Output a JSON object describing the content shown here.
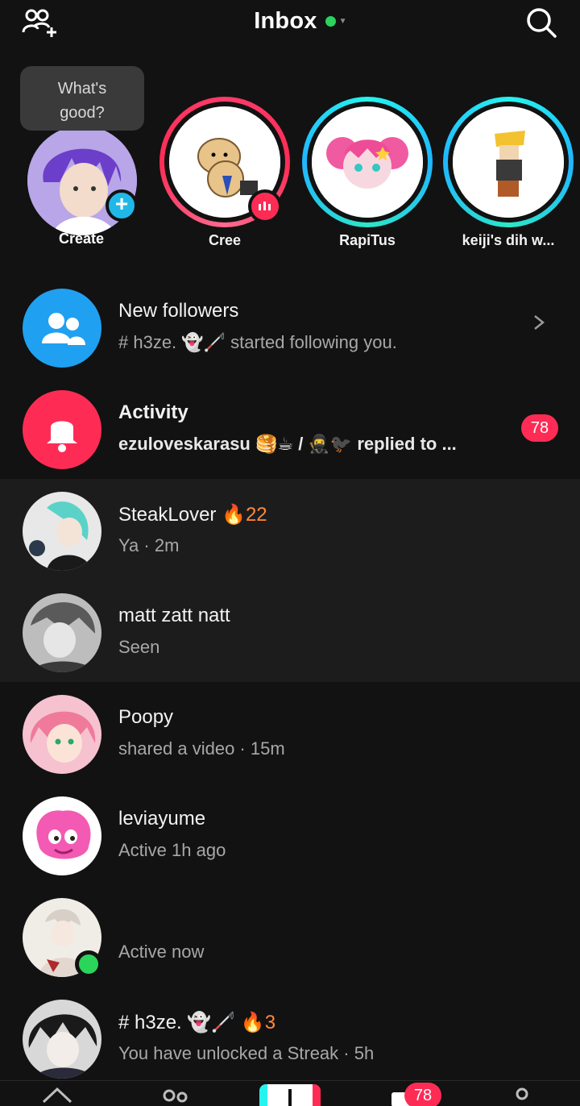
{
  "header": {
    "title": "Inbox",
    "status_color": "#2bd45a",
    "left_icon": "add-friends-icon",
    "right_icon": "search-icon"
  },
  "stories": {
    "create": {
      "name": "Create",
      "bubble_text_1": "What's",
      "bubble_text_2": "good?"
    },
    "items": [
      {
        "name": "Cree",
        "ring": "pink"
      },
      {
        "name": "RapiTus",
        "ring": "teal"
      },
      {
        "name": "keiji's dih w...",
        "ring": "teal"
      }
    ]
  },
  "inbox": {
    "new_followers": {
      "title": "New followers",
      "subtitle": "# h3ze. 👻🦯 started following you."
    },
    "activity": {
      "title": "Activity",
      "subtitle": "ezuloveskarasu 🥞☕ / 🥷🐦‍⬛ replied to ...",
      "badge": "78"
    }
  },
  "conversations": [
    {
      "name": "SteakLover",
      "streak": "🔥22",
      "sub": "Ya · 2m"
    },
    {
      "name": "matt zatt natt",
      "sub": "Seen"
    },
    {
      "name": "Poopy",
      "sub": "shared a video · 15m"
    },
    {
      "name": "leviayume",
      "sub": "Active 1h ago"
    },
    {
      "name": "",
      "sub": "Active now"
    },
    {
      "name": "# h3ze. 👻🦯",
      "streak": "🔥3",
      "sub": "You have unlocked a Streak · 5h"
    }
  ],
  "bottom_nav": {
    "inbox_badge": "78"
  },
  "colors": {
    "accent": "#fe2c55",
    "teal": "#25f4ee",
    "followers_icon_bg": "#20a0f0",
    "online": "#2bd45a"
  }
}
